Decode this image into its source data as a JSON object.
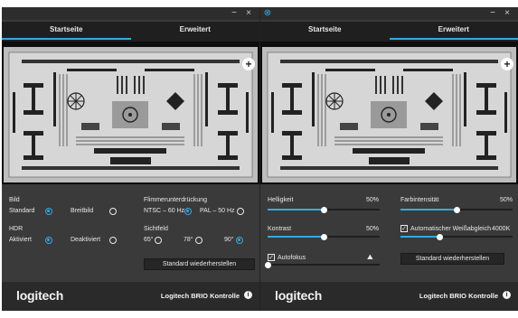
{
  "colors": {
    "accent": "#38a8e0",
    "panel": "#3a3a3a",
    "tabbar": "#1f1f1f",
    "footer": "#2a2a2a"
  },
  "left": {
    "window": {
      "minimize": "−",
      "close": "×"
    },
    "tabs": [
      {
        "label": "Startseite",
        "active": true
      },
      {
        "label": "Erweitert",
        "active": false
      }
    ],
    "bild": {
      "title": "Bild",
      "options": [
        {
          "label": "Standard",
          "selected": true
        },
        {
          "label": "Breitbild",
          "selected": false
        }
      ]
    },
    "hdr": {
      "title": "HDR",
      "options": [
        {
          "label": "Aktiviert",
          "selected": true
        },
        {
          "label": "Deaktiviert",
          "selected": false
        }
      ]
    },
    "flimmer": {
      "title": "Flimmerunterdrückung",
      "options": [
        {
          "label": "NTSC – 60 Hz",
          "selected": true
        },
        {
          "label": "PAL – 50 Hz",
          "selected": false
        }
      ]
    },
    "sichtfeld": {
      "title": "Sichtfeld",
      "options": [
        {
          "label": "65°",
          "selected": false
        },
        {
          "label": "78°",
          "selected": false
        },
        {
          "label": "90°",
          "selected": true
        }
      ]
    },
    "reset_label": "Standard wiederherstellen",
    "footer": {
      "logo": "logitech",
      "brand": "Logitech BRIO Kontrolle",
      "info": "i"
    }
  },
  "right": {
    "window": {
      "pin": "⊗",
      "minimize": "−",
      "close": "×"
    },
    "tabs": [
      {
        "label": "Startseite",
        "active": false
      },
      {
        "label": "Erweitert",
        "active": true
      }
    ],
    "helligkeit": {
      "label": "Helligkeit",
      "value_text": "50%",
      "value": 0.5
    },
    "kontrast": {
      "label": "Kontrast",
      "value_text": "50%",
      "value": 0.5
    },
    "farbintensitaet": {
      "label": "Farbintensität",
      "value_text": "50%",
      "value": 0.5
    },
    "weissabgleich": {
      "label": "Automatischer Weißabgleich",
      "value_text": "4000K",
      "checked": true,
      "value": 0.35
    },
    "autofokus": {
      "label": "Autofokus",
      "checked": true,
      "value": 0.0
    },
    "reset_label": "Standard wiederherstellen",
    "footer": {
      "logo": "logitech",
      "brand": "Logitech BRIO Kontrolle",
      "info": "i"
    }
  }
}
